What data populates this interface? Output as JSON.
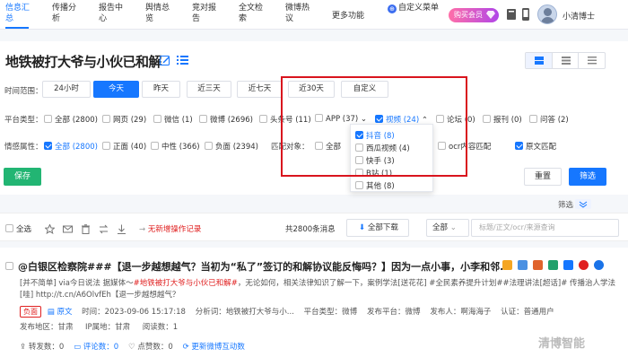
{
  "nav": {
    "items": [
      {
        "label": "信息汇总"
      },
      {
        "label": "传播分析"
      },
      {
        "label": "报告中心"
      },
      {
        "label": "舆情总览"
      },
      {
        "label": "竞对报告"
      },
      {
        "label": "全文检索"
      },
      {
        "label": "微博热议"
      }
    ],
    "more": "更多功能",
    "custom_menu": "自定义菜单",
    "vip": "购买会员",
    "username": "小清博士"
  },
  "title": "地铁被打大爷与小伙已和解",
  "time_range": {
    "label": "时间范围：",
    "options": [
      "24小时",
      "今天",
      "昨天",
      "近三天",
      "近七天",
      "近30天",
      "自定义"
    ],
    "selected": "今天"
  },
  "platform": {
    "label": "平台类型：",
    "options": [
      "全部 (2800)",
      "网页 (29)",
      "微信 (1)",
      "微博 (2696)",
      "头条号 (11)",
      "APP (37)",
      "视频 (24)",
      "论坛 (0)",
      "报刊 (0)",
      "问答 (2)"
    ]
  },
  "sentiment": {
    "label": "情感属性：",
    "options": [
      "全部 (2800)",
      "正面 (40)",
      "中性 (366)",
      "负面 (2394)"
    ]
  },
  "match": {
    "label": "匹配对象：",
    "all": "全部",
    "ocr": "ocr内容匹配",
    "original": "原文匹配"
  },
  "video_dropdown": {
    "items": [
      "抖音 (8)",
      "西瓜视频 (4)",
      "快手 (3)",
      "B站 (1)",
      "其他 (8)"
    ]
  },
  "buttons": {
    "save": "保存",
    "reset": "重置",
    "filter": "筛选",
    "collapse": "筛选"
  },
  "toolbar": {
    "select_all": "全选",
    "no_record": "无新增操作记录",
    "count": "共2800条消息",
    "download_all": "全部下载",
    "select_value": "全部",
    "search_placeholder": "标题/正文/ocr/来源查询"
  },
  "article": {
    "title": "@白银区检察院###【退一步越想越气？当初为“私了”签订的和解协议能反悔吗？】因为一点小事，小李和邻...",
    "snippet_pre": "[并不简单] via今日说法 据媒体～",
    "snippet_hl": "#地铁被打大爷与小伙已和解#",
    "snippet_post": "，无论如何，相关法律知识了解一下，案例学法[送花花] #全民素养提升计划##法理讲法[超话]# 传播治人学法[哇] http://t.cn/A6OlvfEh【退一步越想越气？",
    "negative": "负面",
    "original": "原文",
    "time": "时间：2023-09-06 15:17:18",
    "analysis": "分析词：地铁被打大爷与小...",
    "platform_type": "平台类型：微博",
    "publish_platform": "发布平台：微博",
    "publisher": "发布人：啊海海子",
    "auth": "认证：普通用户",
    "place": "发布地区：甘肃",
    "ip": "IP属地：甘肃",
    "readcount": "阅读数：1",
    "forwards": "转发数：0",
    "comments": "评论数：0",
    "likes": "点赞数：0",
    "update": "更新微博互动数"
  },
  "watermark": "清博智能",
  "colors": {
    "accent": "#1677ff",
    "save": "#22b573",
    "highlight_box": "#d9141e"
  }
}
